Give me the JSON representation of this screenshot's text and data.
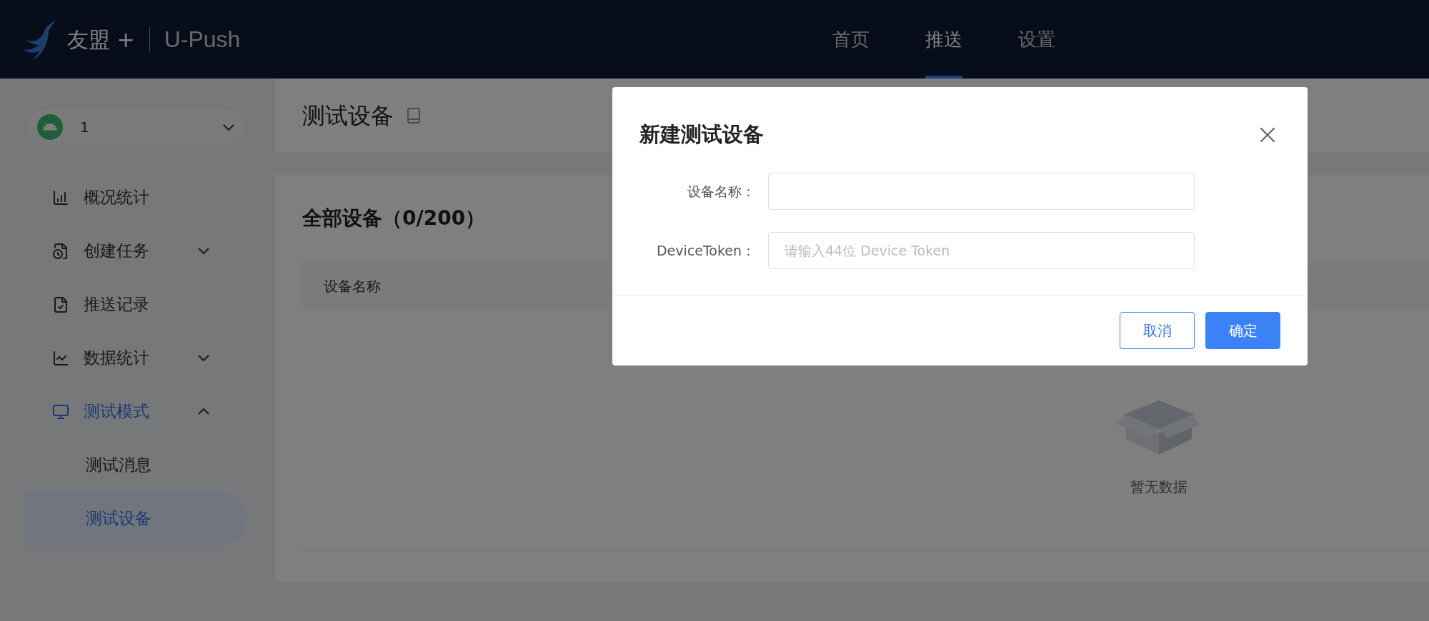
{
  "header": {
    "logo_text": "友盟 +",
    "product": "U-Push",
    "nav": [
      {
        "label": "首页",
        "selected": false
      },
      {
        "label": "推送",
        "selected": true
      },
      {
        "label": "设置",
        "selected": false
      }
    ]
  },
  "app_selector": {
    "value": "1"
  },
  "sidebar": {
    "items": [
      {
        "label": "概况统计"
      },
      {
        "label": "创建任务",
        "expanded": false
      },
      {
        "label": "推送记录"
      },
      {
        "label": "数据统计",
        "expanded": false
      },
      {
        "label": "测试模式",
        "expanded": true,
        "children": [
          {
            "label": "测试消息",
            "selected": false
          },
          {
            "label": "测试设备",
            "selected": true
          }
        ]
      }
    ]
  },
  "page_title": "测试设备",
  "devices_card": {
    "title": "全部设备（0/200）",
    "table": {
      "columns": [
        "设备名称"
      ],
      "empty_text": "暂无数据"
    }
  },
  "dialog": {
    "title": "新建测试设备",
    "fields": [
      {
        "label": "设备名称："
      },
      {
        "label": "DeviceToken：",
        "placeholder": "请输入44位 Device Token"
      }
    ],
    "buttons": [
      {
        "label": "取消",
        "kind": "secondary"
      },
      {
        "label": "确定",
        "kind": "primary"
      }
    ]
  }
}
